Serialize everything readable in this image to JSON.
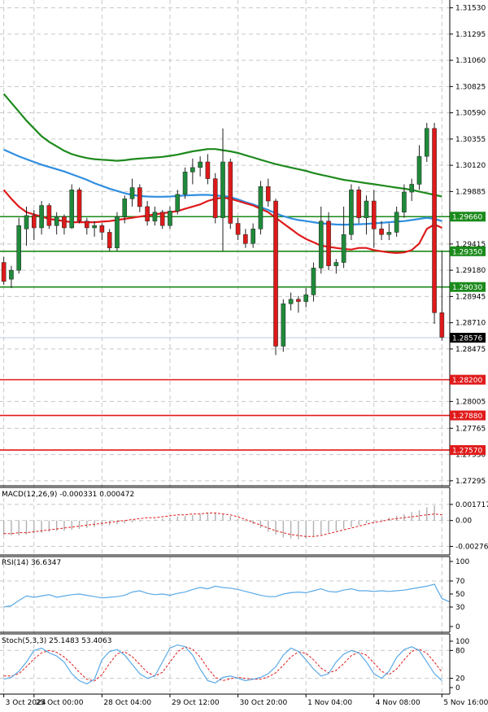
{
  "colors": {
    "bull": "#1f8a3a",
    "bear": "#dd1a1a",
    "ma_long": "#1e8a1e",
    "ma_mid": "#2f8ee0",
    "ma_short": "#e01a1a",
    "support": "#e01a1a",
    "resistance": "#1a8a1a",
    "indicator": "#5aa9e6",
    "signal": "#e01a1a",
    "grid": "#c8c8c8"
  },
  "chart_data": [
    {
      "type": "candlestick",
      "y_ticks": [
        "1.31530",
        "1.31295",
        "1.31060",
        "1.30825",
        "1.30590",
        "1.30355",
        "1.30120",
        "1.29885",
        "1.29415",
        "1.29180",
        "1.28945",
        "1.28710",
        "1.28475",
        "1.28005",
        "1.27765",
        "1.27530",
        "1.27295"
      ],
      "ylim": [
        1.2725,
        1.316
      ],
      "x_tick_labels": [
        "3 Oct 2024",
        "25 Oct 00:00",
        "28 Oct 04:00",
        "29 Oct 12:00",
        "30 Oct 20:00",
        "1 Nov 04:00",
        "4 Nov 08:00",
        "5 Nov 16:00"
      ],
      "current_price": "1.28576",
      "resistance_levels": [
        "1.29660",
        "1.29350",
        "1.29030"
      ],
      "support_levels": [
        "1.28200",
        "1.27880",
        "1.27570"
      ],
      "candles": [
        [
          1.2925,
          1.293,
          1.2905,
          1.2908
        ],
        [
          1.291,
          1.2922,
          1.2902,
          1.2918
        ],
        [
          1.2918,
          1.2965,
          1.2915,
          1.2958
        ],
        [
          1.2955,
          1.2975,
          1.294,
          1.2967
        ],
        [
          1.2967,
          1.2972,
          1.2945,
          1.2956
        ],
        [
          1.2956,
          1.298,
          1.295,
          1.2976
        ],
        [
          1.2976,
          1.2978,
          1.2955,
          1.2958
        ],
        [
          1.2958,
          1.297,
          1.295,
          1.2966
        ],
        [
          1.2966,
          1.2968,
          1.295,
          1.2956
        ],
        [
          1.2956,
          1.2995,
          1.2955,
          1.299
        ],
        [
          1.299,
          1.2992,
          1.296,
          1.2962
        ],
        [
          1.2962,
          1.2965,
          1.295,
          1.2956
        ],
        [
          1.2956,
          1.2962,
          1.2948,
          1.2958
        ],
        [
          1.2958,
          1.296,
          1.2945,
          1.2952
        ],
        [
          1.2952,
          1.2955,
          1.2935,
          1.2938
        ],
        [
          1.2938,
          1.297,
          1.2935,
          1.2966
        ],
        [
          1.2966,
          1.2985,
          1.296,
          1.2982
        ],
        [
          1.2982,
          1.3,
          1.2975,
          1.2992
        ],
        [
          1.2992,
          1.2995,
          1.297,
          1.2975
        ],
        [
          1.2975,
          1.298,
          1.2958,
          1.2962
        ],
        [
          1.2962,
          1.2975,
          1.2958,
          1.297
        ],
        [
          1.297,
          1.2972,
          1.2955,
          1.2958
        ],
        [
          1.2958,
          1.2975,
          1.2955,
          1.2971
        ],
        [
          1.2971,
          1.299,
          1.2968,
          1.2986
        ],
        [
          1.2986,
          1.301,
          1.2982,
          1.3006
        ],
        [
          1.3006,
          1.3018,
          1.2995,
          1.301
        ],
        [
          1.301,
          1.302,
          1.3002,
          1.3015
        ],
        [
          1.3015,
          1.3022,
          1.2995,
          1.3
        ],
        [
          1.3,
          1.3005,
          1.296,
          1.2965
        ],
        [
          1.2965,
          1.3045,
          1.2935,
          1.3015
        ],
        [
          1.3015,
          1.3018,
          1.2955,
          1.296
        ],
        [
          1.296,
          1.2965,
          1.2945,
          1.295
        ],
        [
          1.295,
          1.2955,
          1.2938,
          1.2942
        ],
        [
          1.2942,
          1.296,
          1.2938,
          1.2955
        ],
        [
          1.2955,
          1.2998,
          1.295,
          1.2993
        ],
        [
          1.2993,
          1.3,
          1.2975,
          1.298
        ],
        [
          1.298,
          1.2982,
          1.2842,
          1.285
        ],
        [
          1.285,
          1.2892,
          1.2845,
          1.2888
        ],
        [
          1.2888,
          1.2898,
          1.2882,
          1.2892
        ],
        [
          1.2892,
          1.2895,
          1.288,
          1.289
        ],
        [
          1.289,
          1.2902,
          1.2885,
          1.2896
        ],
        [
          1.2896,
          1.2925,
          1.289,
          1.292
        ],
        [
          1.292,
          1.2975,
          1.2915,
          1.2962
        ],
        [
          1.2962,
          1.297,
          1.2918,
          1.2922
        ],
        [
          1.2922,
          1.2928,
          1.2915,
          1.2925
        ],
        [
          1.2925,
          1.2975,
          1.292,
          1.295
        ],
        [
          1.295,
          1.2995,
          1.2945,
          1.299
        ],
        [
          1.299,
          1.2993,
          1.296,
          1.2965
        ],
        [
          1.2965,
          1.2985,
          1.295,
          1.298
        ],
        [
          1.298,
          1.299,
          1.2938,
          1.2955
        ],
        [
          1.2955,
          1.2962,
          1.2945,
          1.295
        ],
        [
          1.295,
          1.296,
          1.2945,
          1.2952
        ],
        [
          1.2952,
          1.2975,
          1.2948,
          1.297
        ],
        [
          1.297,
          1.2995,
          1.2965,
          1.2988
        ],
        [
          1.2988,
          1.3,
          1.298,
          1.2995
        ],
        [
          1.2995,
          1.303,
          1.299,
          1.302
        ],
        [
          1.302,
          1.305,
          1.3015,
          1.3045
        ],
        [
          1.3045,
          1.305,
          1.287,
          1.288
        ],
        [
          1.288,
          1.2935,
          1.2855,
          1.2858
        ]
      ],
      "ma_long": [
        1.3076,
        1.3068,
        1.306,
        1.3052,
        1.3045,
        1.3038,
        1.3033,
        1.3029,
        1.3025,
        1.3022,
        1.302,
        1.30185,
        1.30175,
        1.3017,
        1.30165,
        1.3016,
        1.30165,
        1.30175,
        1.3018,
        1.30185,
        1.3019,
        1.30195,
        1.30205,
        1.30215,
        1.3023,
        1.30245,
        1.30255,
        1.30265,
        1.30265,
        1.30255,
        1.30245,
        1.3023,
        1.3021,
        1.3019,
        1.3017,
        1.3015,
        1.3013,
        1.30115,
        1.301,
        1.30085,
        1.3007,
        1.3005,
        1.30035,
        1.3002,
        1.30005,
        1.2999,
        1.2998,
        1.2997,
        1.2996,
        1.2995,
        1.2994,
        1.2993,
        1.2992,
        1.2991,
        1.299,
        1.29885,
        1.2987,
        1.29855,
        1.2984
      ],
      "ma_mid": [
        1.3026,
        1.3023,
        1.302,
        1.30175,
        1.3015,
        1.30125,
        1.30105,
        1.30085,
        1.30065,
        1.3004,
        1.30015,
        1.2999,
        1.2996,
        1.29935,
        1.2991,
        1.2989,
        1.2987,
        1.29855,
        1.29845,
        1.2984,
        1.29838,
        1.29838,
        1.2984,
        1.29845,
        1.2985,
        1.29852,
        1.29855,
        1.29855,
        1.2985,
        1.29845,
        1.29835,
        1.29815,
        1.2979,
        1.2977,
        1.29745,
        1.2972,
        1.2969,
        1.29665,
        1.29645,
        1.2963,
        1.2962,
        1.2961,
        1.296,
        1.29595,
        1.2959,
        1.29588,
        1.2959,
        1.29592,
        1.29595,
        1.296,
        1.29605,
        1.2961,
        1.29615,
        1.2962,
        1.2963,
        1.2964,
        1.2965,
        1.2964,
        1.2962
      ],
      "ma_short": [
        1.299,
        1.2982,
        1.2975,
        1.297,
        1.2968,
        1.2966,
        1.2964,
        1.2963,
        1.2962,
        1.2961,
        1.2961,
        1.2961,
        1.2961,
        1.29615,
        1.2962,
        1.2963,
        1.2964,
        1.2965,
        1.2966,
        1.2967,
        1.2968,
        1.2969,
        1.297,
        1.2971,
        1.2973,
        1.2975,
        1.2977,
        1.298,
        1.2982,
        1.2983,
        1.2982,
        1.298,
        1.2978,
        1.2976,
        1.2973,
        1.297,
        1.2965,
        1.296,
        1.2955,
        1.295,
        1.2946,
        1.2943,
        1.294,
        1.2939,
        1.2938,
        1.2937,
        1.29365,
        1.2938,
        1.2938,
        1.2936,
        1.2935,
        1.2934,
        1.29335,
        1.2934,
        1.2936,
        1.2942,
        1.2955,
        1.2959,
        1.2956
      ]
    },
    {
      "type": "bar",
      "title": "MACD(12,26,9) -0.000331 0.000472",
      "y_ticks": [
        "0.001717",
        "0.00",
        "-0.00276"
      ],
      "ylim": [
        -0.0035,
        0.0024
      ],
      "histogram": [
        -0.0015,
        -0.0016,
        -0.0016,
        -0.0015,
        -0.0014,
        -0.0013,
        -0.0012,
        -0.0011,
        -0.0011,
        -0.001,
        -0.0009,
        -0.0008,
        -0.0007,
        -0.0006,
        -0.0005,
        -0.0004,
        -0.0003,
        -0.0002,
        -0.0001,
        0.0,
        0.0001,
        0.0002,
        0.0003,
        0.0004,
        0.0005,
        0.0006,
        0.0007,
        0.0008,
        0.0008,
        0.0007,
        0.0005,
        0.0002,
        -0.0001,
        -0.0004,
        -0.0008,
        -0.0012,
        -0.0015,
        -0.0018,
        -0.0019,
        -0.002,
        -0.0019,
        -0.0017,
        -0.0015,
        -0.0013,
        -0.0011,
        -0.0009,
        -0.0007,
        -0.0005,
        -0.0003,
        -0.0001,
        0.0001,
        0.0003,
        0.0005,
        0.0007,
        0.0009,
        0.0011,
        0.0014,
        0.0016,
        0.0004
      ],
      "signal": [
        -0.0014,
        -0.0014,
        -0.0013,
        -0.0013,
        -0.0012,
        -0.0011,
        -0.001,
        -0.0009,
        -0.0008,
        -0.0007,
        -0.0006,
        -0.0005,
        -0.0004,
        -0.0003,
        -0.0002,
        -0.0001,
        0.0,
        0.0001,
        0.0002,
        0.0003,
        0.0003,
        0.0004,
        0.0005,
        0.0006,
        0.0006,
        0.0007,
        0.0007,
        0.0008,
        0.0008,
        0.0007,
        0.0006,
        0.0004,
        0.0001,
        -0.0002,
        -0.0005,
        -0.0008,
        -0.0011,
        -0.0013,
        -0.0015,
        -0.0016,
        -0.0017,
        -0.0017,
        -0.0016,
        -0.0014,
        -0.0012,
        -0.001,
        -0.0008,
        -0.0006,
        -0.0004,
        -0.0002,
        -0.0001,
        0.0001,
        0.0002,
        0.0003,
        0.0004,
        0.0005,
        0.0006,
        0.0007,
        0.0006
      ]
    },
    {
      "type": "line",
      "title": "RSI(14) 36.6347",
      "y_ticks": [
        "100",
        "70",
        "50",
        "30",
        "0"
      ],
      "ylim": [
        0,
        100
      ],
      "values": [
        30,
        32,
        40,
        47,
        45,
        47,
        49,
        45,
        47,
        49,
        50,
        48,
        46,
        44,
        45,
        46,
        48,
        53,
        55,
        51,
        49,
        50,
        48,
        51,
        53,
        57,
        60,
        58,
        62,
        60,
        59,
        57,
        54,
        51,
        48,
        46,
        46,
        50,
        52,
        53,
        52,
        55,
        58,
        54,
        53,
        56,
        58,
        55,
        55,
        54,
        55,
        54,
        55,
        56,
        58,
        60,
        62,
        65,
        43,
        38
      ]
    },
    {
      "type": "line",
      "title": "Stoch(5,3,3) 25.1483 53.4063",
      "y_ticks": [
        "100",
        "80",
        "20",
        "0"
      ],
      "ylim": [
        0,
        100
      ],
      "k": [
        18,
        22,
        35,
        55,
        80,
        85,
        75,
        68,
        55,
        30,
        15,
        8,
        18,
        60,
        78,
        82,
        70,
        50,
        30,
        20,
        25,
        55,
        85,
        92,
        88,
        70,
        40,
        15,
        10,
        22,
        25,
        20,
        15,
        18,
        22,
        30,
        45,
        70,
        85,
        78,
        60,
        40,
        25,
        30,
        55,
        72,
        80,
        75,
        55,
        30,
        20,
        35,
        65,
        82,
        88,
        80,
        55,
        30,
        15
      ],
      "d": [
        25,
        25,
        30,
        45,
        62,
        75,
        80,
        76,
        66,
        51,
        33,
        18,
        14,
        28,
        52,
        73,
        77,
        67,
        50,
        33,
        25,
        33,
        55,
        77,
        88,
        83,
        66,
        42,
        22,
        15,
        19,
        22,
        20,
        18,
        18,
        23,
        32,
        48,
        66,
        77,
        74,
        60,
        42,
        32,
        37,
        52,
        69,
        76,
        70,
        53,
        35,
        28,
        40,
        60,
        78,
        83,
        74,
        55,
        33
      ]
    }
  ]
}
